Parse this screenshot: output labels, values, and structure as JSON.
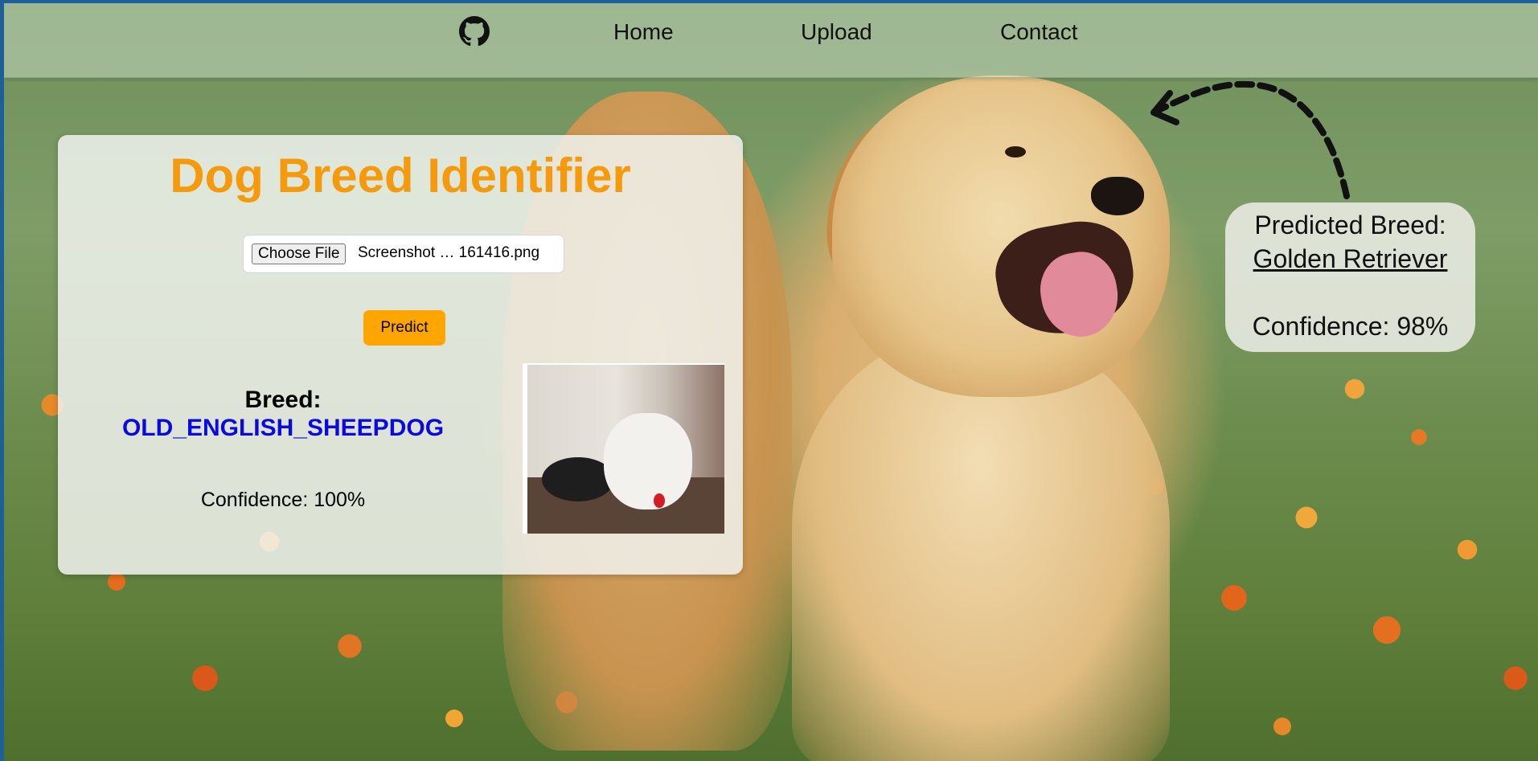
{
  "nav": {
    "github_icon": "github-icon",
    "links": [
      "Home",
      "Upload",
      "Contact"
    ]
  },
  "card": {
    "title": "Dog Breed Identifier",
    "file_input": {
      "button_label": "Choose File",
      "file_name": "Screenshot … 161416.png"
    },
    "predict_label": "Predict",
    "breed_label": "Breed:",
    "breed_value": "OLD_ENGLISH_SHEEPDOG",
    "confidence_text": "Confidence: 100%"
  },
  "annotation": {
    "label": "Predicted Breed:",
    "breed": "Golden Retriever",
    "confidence": "Confidence: 98%"
  },
  "colors": {
    "title": "#f59a0c",
    "predict_button": "#ffa500",
    "breed_value": "#0a0ae0"
  }
}
